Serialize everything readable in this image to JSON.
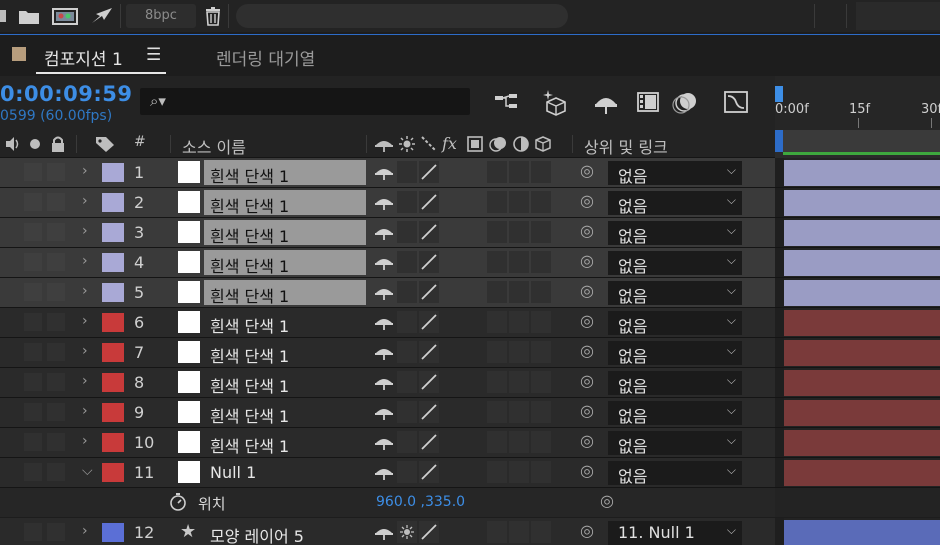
{
  "toolbar": {
    "bpc_label": "8bpc",
    "icons": [
      "folder-icon",
      "composition-icon",
      "render-icon",
      "trash-icon"
    ]
  },
  "tabs": {
    "composition": "컴포지션 1",
    "render_queue": "렌더링 대기열"
  },
  "time": {
    "timecode": "0:00:09:59",
    "frames": "0599 (60.00fps)"
  },
  "ruler": {
    "labels": [
      "0:00f",
      "15f",
      "30f"
    ]
  },
  "columns": {
    "number": "#",
    "source_name": "소스 이름",
    "parent_link": "상위 및 링크"
  },
  "colors": {
    "accent_blue": "#3d8ee6",
    "label_lavender": "#a9a9d6",
    "label_red": "#c83a3a",
    "label_blue": "#5b6fd6",
    "bar_lavender": "#9a9cc4",
    "bar_red": "#7a3a3a",
    "bar_blue": "#5a6bb8",
    "selection_gray": "#9a9a9a"
  },
  "layers": [
    {
      "num": "1",
      "name": "흰색 단색 1",
      "label": "lavender",
      "selected": true,
      "parent": "없음"
    },
    {
      "num": "2",
      "name": "흰색 단색 1",
      "label": "lavender",
      "selected": true,
      "parent": "없음"
    },
    {
      "num": "3",
      "name": "흰색 단색 1",
      "label": "lavender",
      "selected": true,
      "parent": "없음"
    },
    {
      "num": "4",
      "name": "흰색 단색 1",
      "label": "lavender",
      "selected": true,
      "parent": "없음"
    },
    {
      "num": "5",
      "name": "흰색 단색 1",
      "label": "lavender",
      "selected": true,
      "parent": "없음"
    },
    {
      "num": "6",
      "name": "흰색 단색 1",
      "label": "red",
      "selected": false,
      "parent": "없음"
    },
    {
      "num": "7",
      "name": "흰색 단색 1",
      "label": "red",
      "selected": false,
      "parent": "없음"
    },
    {
      "num": "8",
      "name": "흰색 단색 1",
      "label": "red",
      "selected": false,
      "parent": "없음"
    },
    {
      "num": "9",
      "name": "흰색 단색 1",
      "label": "red",
      "selected": false,
      "parent": "없음"
    },
    {
      "num": "10",
      "name": "흰색 단색 1",
      "label": "red",
      "selected": false,
      "parent": "없음"
    },
    {
      "num": "11",
      "name": "Null 1",
      "label": "red",
      "selected": false,
      "parent": "없음",
      "expanded": true
    }
  ],
  "property": {
    "name": "위치",
    "value": "960.0 ,335.0"
  },
  "layer12": {
    "num": "12",
    "name": "모양 레이어 5",
    "parent": "11. Null 1"
  }
}
